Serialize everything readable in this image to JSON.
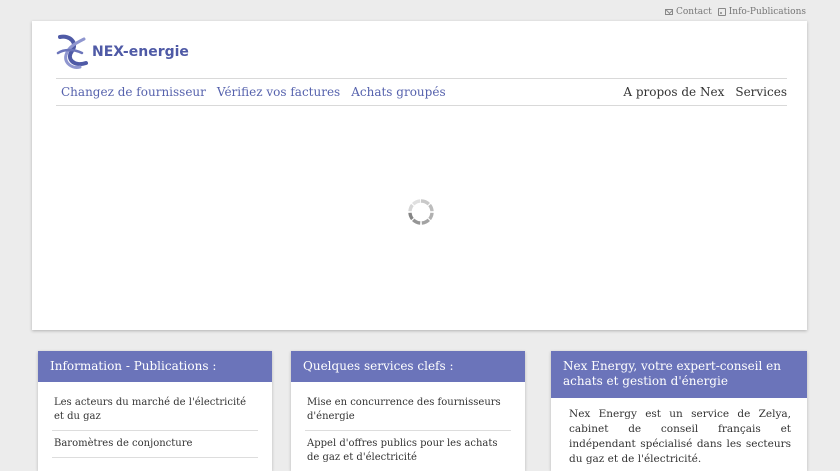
{
  "top_links": {
    "contact": "Contact",
    "info": "Info-Publications"
  },
  "brand": {
    "name": "NEX-energie",
    "accent": "#5662ad",
    "header_bg": "#6b74ba"
  },
  "nav": {
    "left": [
      "Changez de fournisseur",
      "Vérifiez vos factures",
      "Achats groupés"
    ],
    "right": [
      "A propos de Nex",
      "Services"
    ]
  },
  "cards": {
    "info": {
      "title": "Information - Publications :",
      "items": [
        "Les acteurs du marché de l'électricité et du gaz",
        "Baromètres de conjoncture",
        ""
      ]
    },
    "services": {
      "title": "Quelques services clefs :",
      "items": [
        "Mise en concurrence des fournisseurs d'énergie",
        "Appel d'offres publics pour les achats de gaz et d'électricité"
      ]
    },
    "about": {
      "title": "Nex Energy, votre expert-conseil en achats et gestion d'énergie",
      "text": "Nex Energy est un service de Zelya, cabinet de conseil français et indépendant spécialisé dans les secteurs du gaz et de l'électricité."
    }
  }
}
